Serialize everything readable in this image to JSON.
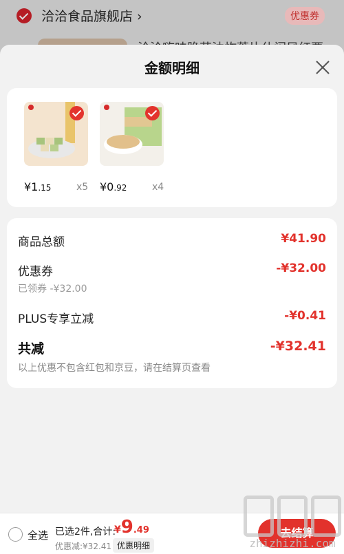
{
  "background": {
    "shop_name": "洽洽食品旗舰店 ›",
    "coupon_tag": "优惠券",
    "item_title": "洽洽嗨味脆花油炸蒌片休闲风红栗"
  },
  "sheet": {
    "title": "金额明细",
    "products": [
      {
        "price_int": "¥1",
        "price_dec": ".15",
        "qty": "x5"
      },
      {
        "price_int": "¥0",
        "price_dec": ".92",
        "qty": "x4"
      }
    ],
    "summary": {
      "goods_total_label": "商品总额",
      "goods_total_value": "¥41.90",
      "coupon_label": "优惠券",
      "coupon_value": "-¥32.00",
      "coupon_sub": "已领券 -¥32.00",
      "plus_label": "PLUS专享立减",
      "plus_value": "-¥0.41",
      "total_reduce_label": "共减",
      "total_reduce_value": "-¥32.41",
      "note": "以上优惠不包含红包和京豆，请在结算页查看"
    }
  },
  "bottom_bar": {
    "select_all": "全选",
    "selected_text": "已选2件,合计:",
    "total_yen": "¥",
    "total_int": "9",
    "total_dec": ".49",
    "discount_text": "优惠减:¥32.41",
    "detail_button": "优惠明细",
    "checkout_button": "去结算"
  },
  "watermark": {
    "text": "zhizhizhi.com"
  },
  "colors": {
    "accent": "#e2322c",
    "sheet_bg": "#f2f2f2"
  }
}
